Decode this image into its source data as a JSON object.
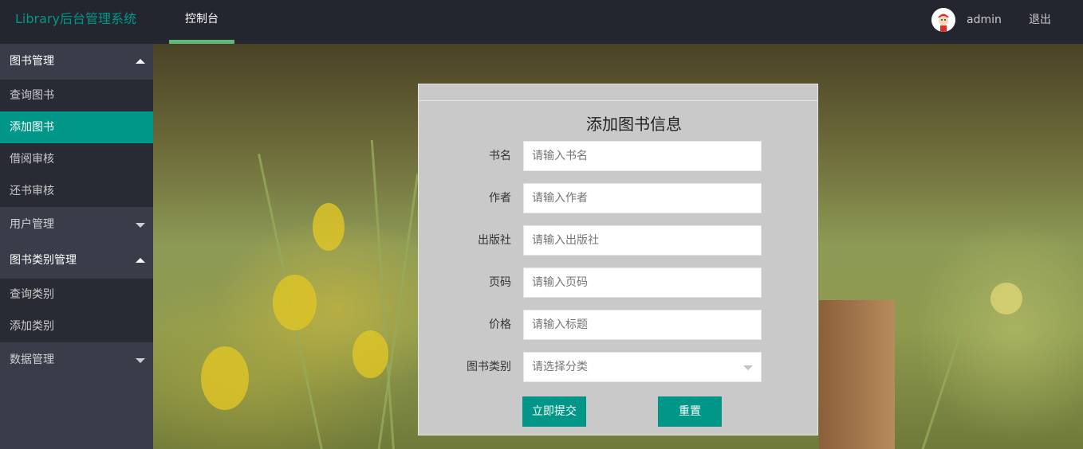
{
  "header": {
    "logo": "Library后台管理系统",
    "nav_tab": "控制台",
    "username": "admin",
    "logout": "退出"
  },
  "sidebar": {
    "groups": [
      {
        "label": "图书管理",
        "expanded": true,
        "items": [
          "查询图书",
          "添加图书",
          "借阅审核",
          "还书审核"
        ]
      },
      {
        "label": "用户管理",
        "expanded": false,
        "items": []
      },
      {
        "label": "图书类别管理",
        "expanded": true,
        "items": [
          "查询类别",
          "添加类别"
        ]
      },
      {
        "label": "数据管理",
        "expanded": false,
        "items": []
      }
    ],
    "active_item": "添加图书"
  },
  "form": {
    "title": "添加图书信息",
    "fields": [
      {
        "label": "书名",
        "placeholder": "请输入书名"
      },
      {
        "label": "作者",
        "placeholder": "请输入作者"
      },
      {
        "label": "出版社",
        "placeholder": "请输入出版社"
      },
      {
        "label": "页码",
        "placeholder": "请输入页码"
      },
      {
        "label": "价格",
        "placeholder": "请输入标题"
      },
      {
        "label": "图书类别",
        "placeholder": "请选择分类"
      }
    ],
    "submit_label": "立即提交",
    "reset_label": "重置"
  },
  "colors": {
    "accent": "#009688",
    "header_bg": "#23262e",
    "sidebar_bg": "#393d49",
    "tab_indicator": "#5fb878"
  }
}
